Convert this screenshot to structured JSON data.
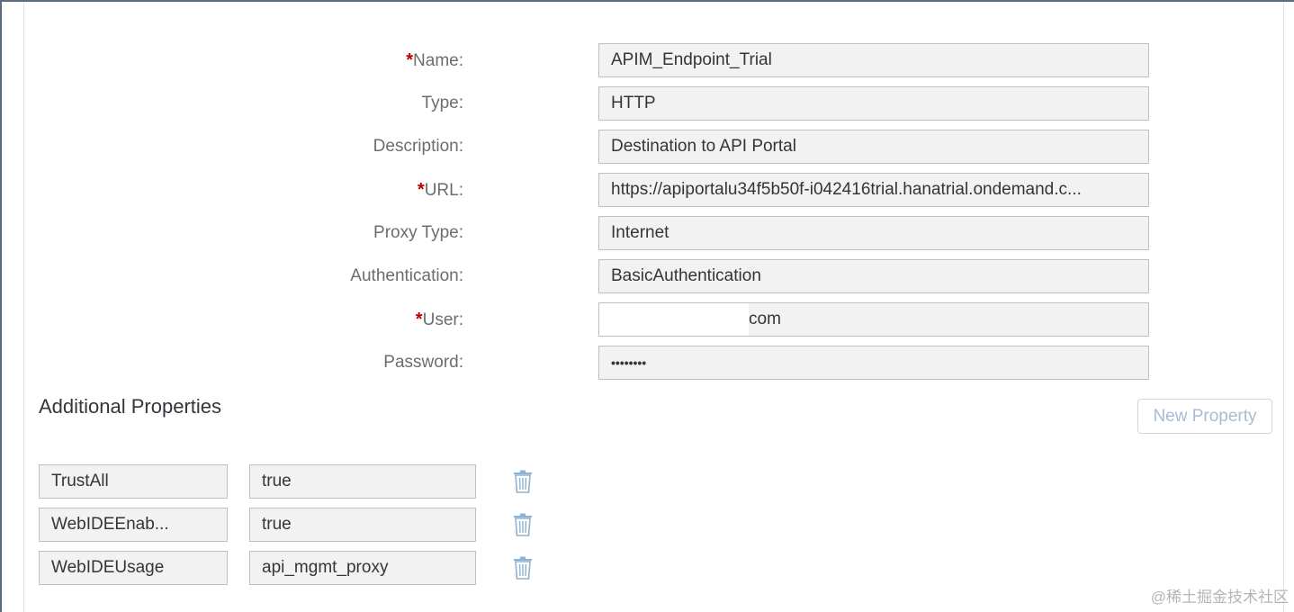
{
  "form": {
    "name": {
      "label": "Name:",
      "required": "*",
      "value": "APIM_Endpoint_Trial"
    },
    "type": {
      "label": "Type:",
      "value": "HTTP"
    },
    "description": {
      "label": "Description:",
      "value": "Destination to API Portal"
    },
    "url": {
      "label": "URL:",
      "required": "*",
      "value": "https://apiportalu34f5b50f-i042416trial.hanatrial.ondemand.c..."
    },
    "proxy_type": {
      "label": "Proxy Type:",
      "value": "Internet"
    },
    "authentication": {
      "label": "Authentication:",
      "value": "BasicAuthentication"
    },
    "user": {
      "label": "User:",
      "required": "*",
      "value_visible": "com"
    },
    "password": {
      "label": "Password:",
      "value": "••••••••"
    }
  },
  "additional_properties": {
    "title": "Additional Properties",
    "new_property_label": "New Property",
    "rows": [
      {
        "key": "TrustAll",
        "value": "true",
        "delete_icon": "trash-icon"
      },
      {
        "key": "WebIDEEnab...",
        "value": "true",
        "delete_icon": "trash-icon"
      },
      {
        "key": "WebIDEUsage",
        "value": "api_mgmt_proxy",
        "delete_icon": "trash-icon"
      }
    ]
  },
  "watermark": "@稀土掘金技术社区",
  "colors": {
    "required": "#bb0000",
    "label": "#6a6d70",
    "field_bg": "#f2f2f2",
    "icon": "#8fb2d4",
    "button_text": "#a5bdd4"
  }
}
